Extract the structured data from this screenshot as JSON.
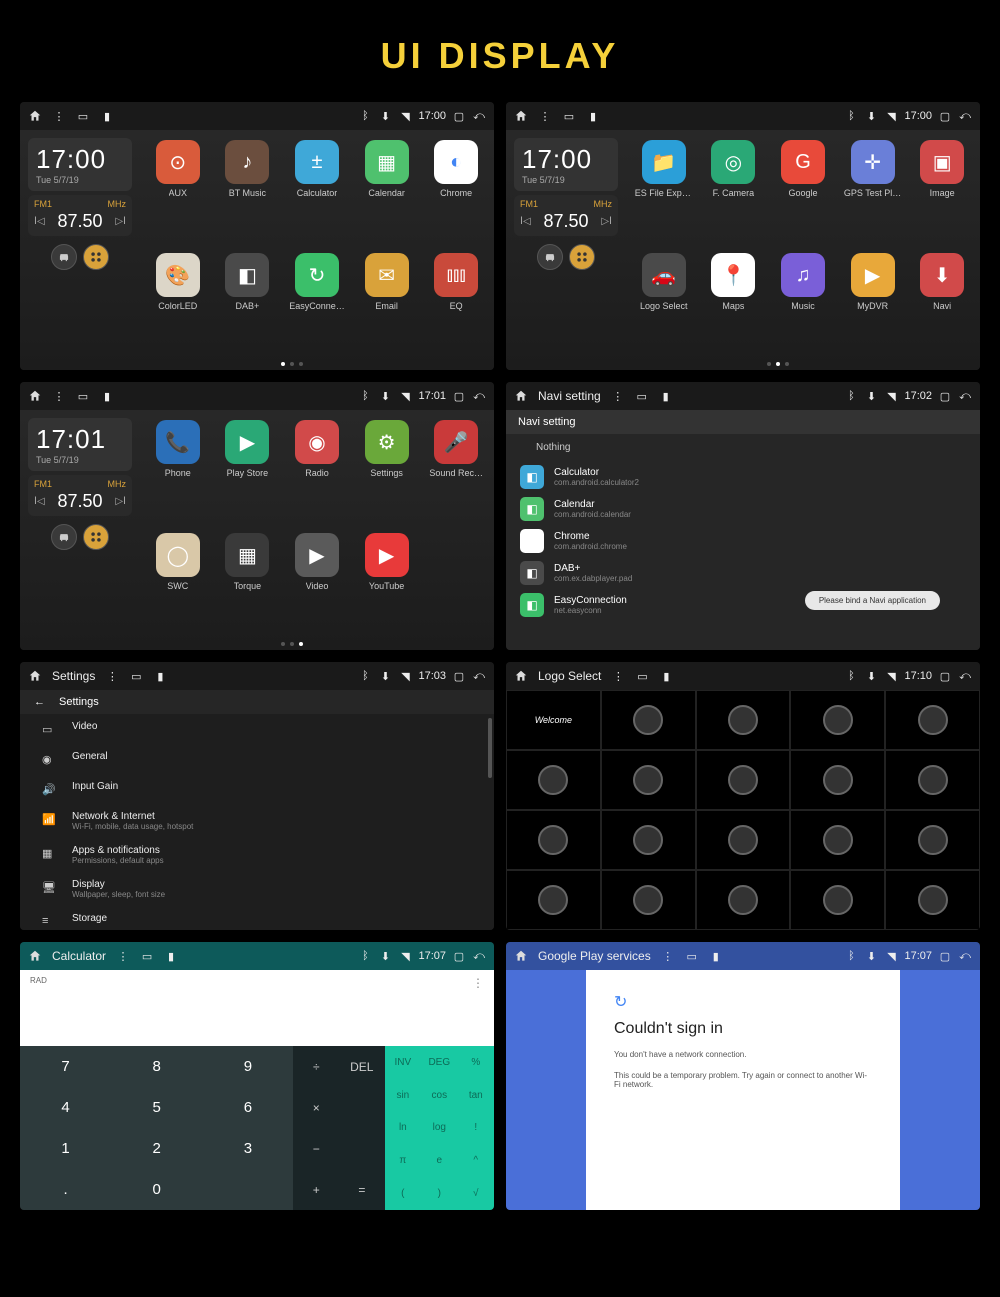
{
  "title": "UI DISPLAY",
  "statusbar_time_1": "17:00",
  "statusbar_time_2": "17:01",
  "statusbar_time_3": "17:02",
  "statusbar_time_4": "17:03",
  "statusbar_time_5": "17:10",
  "statusbar_time_6": "17:07",
  "clock_time": "17:00",
  "clock_time_2": "17:01",
  "clock_date": "Tue 5/7/19",
  "radio_band": "FM1",
  "radio_unit": "MHz",
  "radio_freq": "87.50",
  "screens": {
    "s1_apps": [
      {
        "label": "AUX",
        "color": "#d95b3b",
        "glyph": "⊙"
      },
      {
        "label": "BT Music",
        "color": "#6b4e3e",
        "glyph": "♪"
      },
      {
        "label": "Calculator",
        "color": "#3fa8d8",
        "glyph": "±"
      },
      {
        "label": "Calendar",
        "color": "#4fc16e",
        "glyph": "▦"
      },
      {
        "label": "Chrome",
        "color": "#fff",
        "glyph": "◐"
      },
      {
        "label": "ColorLED",
        "color": "#dcd6c8",
        "glyph": "🎨"
      },
      {
        "label": "DAB+",
        "color": "#4a4a4a",
        "glyph": "◧"
      },
      {
        "label": "EasyConne…",
        "color": "#3bbf6a",
        "glyph": "↻"
      },
      {
        "label": "Email",
        "color": "#d9a23a",
        "glyph": "✉"
      },
      {
        "label": "EQ",
        "color": "#c94a3b",
        "glyph": "⫾⫾⫾"
      }
    ],
    "s2_apps": [
      {
        "label": "ES File Expl…",
        "color": "#2b9fd8",
        "glyph": "📁"
      },
      {
        "label": "F. Camera",
        "color": "#2aa876",
        "glyph": "◎"
      },
      {
        "label": "Google",
        "color": "#e84a3a",
        "glyph": "G"
      },
      {
        "label": "GPS Test Pl…",
        "color": "#6a7fd8",
        "glyph": "✛"
      },
      {
        "label": "Image",
        "color": "#d14a4a",
        "glyph": "▣"
      },
      {
        "label": "Logo Select",
        "color": "#4a4a4a",
        "glyph": "🚗"
      },
      {
        "label": "Maps",
        "color": "#fff",
        "glyph": "📍"
      },
      {
        "label": "Music",
        "color": "#7a5fd8",
        "glyph": "♫"
      },
      {
        "label": "MyDVR",
        "color": "#e8a83a",
        "glyph": "▶"
      },
      {
        "label": "Navi",
        "color": "#d14a4a",
        "glyph": "⬇"
      }
    ],
    "s3_apps": [
      {
        "label": "Phone",
        "color": "#2b6fb8",
        "glyph": "📞"
      },
      {
        "label": "Play Store",
        "color": "#2aa876",
        "glyph": "▶"
      },
      {
        "label": "Radio",
        "color": "#d14a4a",
        "glyph": "◉"
      },
      {
        "label": "Settings",
        "color": "#6aa83a",
        "glyph": "⚙"
      },
      {
        "label": "Sound Rec…",
        "color": "#c93a3a",
        "glyph": "🎤"
      },
      {
        "label": "SWC",
        "color": "#d9c8a8",
        "glyph": "◯"
      },
      {
        "label": "Torque",
        "color": "#3a3a3a",
        "glyph": "▦"
      },
      {
        "label": "Video",
        "color": "#5a5a5a",
        "glyph": "▶"
      },
      {
        "label": "YouTube",
        "color": "#e83a3a",
        "glyph": "▶"
      }
    ]
  },
  "navi": {
    "title": "Navi setting",
    "header": "Navi setting",
    "nothing": "Nothing",
    "toast": "Please bind a Navi application",
    "items": [
      {
        "name": "Calculator",
        "pkg": "com.android.calculator2",
        "color": "#3fa8d8"
      },
      {
        "name": "Calendar",
        "pkg": "com.android.calendar",
        "color": "#4fc16e"
      },
      {
        "name": "Chrome",
        "pkg": "com.android.chrome",
        "color": "#fff"
      },
      {
        "name": "DAB+",
        "pkg": "com.ex.dabplayer.pad",
        "color": "#4a4a4a"
      },
      {
        "name": "EasyConnection",
        "pkg": "net.easyconn",
        "color": "#3bbf6a"
      }
    ]
  },
  "settings": {
    "title": "Settings",
    "header": "Settings",
    "items": [
      {
        "t": "Video"
      },
      {
        "t": "General"
      },
      {
        "t": "Input Gain"
      },
      {
        "t": "Network & Internet",
        "s": "Wi-Fi, mobile, data usage, hotspot"
      },
      {
        "t": "Apps & notifications",
        "s": "Permissions, default apps"
      },
      {
        "t": "Display",
        "s": "Wallpaper, sleep, font size"
      },
      {
        "t": "Storage",
        "s": ""
      }
    ]
  },
  "logo": {
    "title": "Logo Select",
    "welcome": "Welcome"
  },
  "calc": {
    "title": "Calculator",
    "rad": "RAD",
    "nums": [
      "7",
      "8",
      "9",
      "4",
      "5",
      "6",
      "1",
      "2",
      "3",
      ".",
      "0",
      ""
    ],
    "ops": [
      "DEL",
      "÷",
      "×",
      "−",
      "+",
      "="
    ],
    "funcs": [
      "INV",
      "DEG",
      "%",
      "sin",
      "cos",
      "tan",
      "ln",
      "log",
      "!",
      "π",
      "e",
      "^",
      "(",
      ")",
      "√"
    ]
  },
  "play": {
    "title": "Google Play services",
    "h": "Couldn't sign in",
    "p1": "You don't have a network connection.",
    "p2": "This could be a temporary problem. Try again or connect to another Wi-Fi network."
  }
}
